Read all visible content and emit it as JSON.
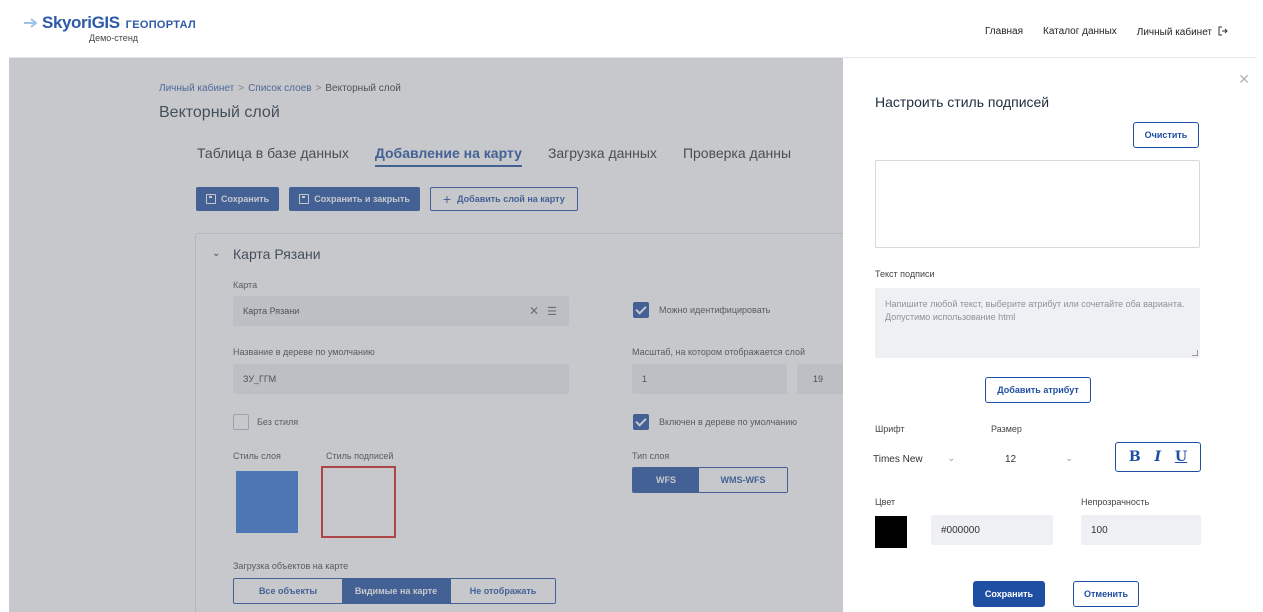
{
  "header": {
    "logo_text": "SkyoriGIS",
    "logo_sub": "ГЕОПОРТАЛ",
    "logo_demo": "Демо-стенд",
    "nav": [
      "Главная",
      "Каталог данных",
      "Личный кабинет"
    ]
  },
  "breadcrumb": {
    "items": [
      "Личный кабинет",
      "Список слоев"
    ],
    "separator": ">",
    "current": "Векторный слой"
  },
  "page_title": "Векторный слой",
  "tabs": [
    "Таблица в базе данных",
    "Добавление на карту",
    "Загрузка данных",
    "Проверка данны"
  ],
  "toolbar": {
    "save": "Сохранить",
    "save_close": "Сохранить и закрыть",
    "add_layer": "Добавить слой на карту"
  },
  "card": {
    "title": "Карта Рязани",
    "map_label": "Карта",
    "map_value": "Карта Рязани",
    "tree_name_label": "Название в дереве по умолчанию",
    "tree_name_value": "ЗУ_ГГМ",
    "no_style_label": "Без стиля",
    "layer_style_label": "Стиль слоя",
    "label_style_label": "Стиль подписей",
    "identify_label": "Можно идентифицировать",
    "scale_label": "Масштаб, на котором отображается слой",
    "scale_min": "1",
    "scale_max": "19",
    "tree_enabled_label": "Включен в дереве по умолчанию",
    "layer_type_label": "Тип слоя",
    "layer_type_options": [
      "WFS",
      "WMS-WFS"
    ],
    "loading_label": "Загрузка объектов на карте",
    "loading_options": [
      "Все объекты",
      "Видимые на карте",
      "Не отображать"
    ]
  },
  "panel": {
    "title": "Настроить стиль подписей",
    "clear": "Очистить",
    "text_label": "Текст подписи",
    "text_placeholder": "Напишите любой текст, выберите атрибут или сочетайте оба варианта. Допустимо использование html",
    "add_attr": "Добавить атрибут",
    "font_label": "Шрифт",
    "font_value": "Times New",
    "size_label": "Размер",
    "size_value": "12",
    "bold": "B",
    "italic": "I",
    "underline": "U",
    "color_label": "Цвет",
    "color_value": "#000000",
    "opacity_label": "Непрозрачность",
    "opacity_value": "100",
    "save": "Сохранить",
    "cancel": "Отменить"
  },
  "colors": {
    "accent": "#1f4fa3",
    "layer_style_swatch": "#2f73d9",
    "highlight": "#d62020",
    "label_color": "#000000"
  }
}
